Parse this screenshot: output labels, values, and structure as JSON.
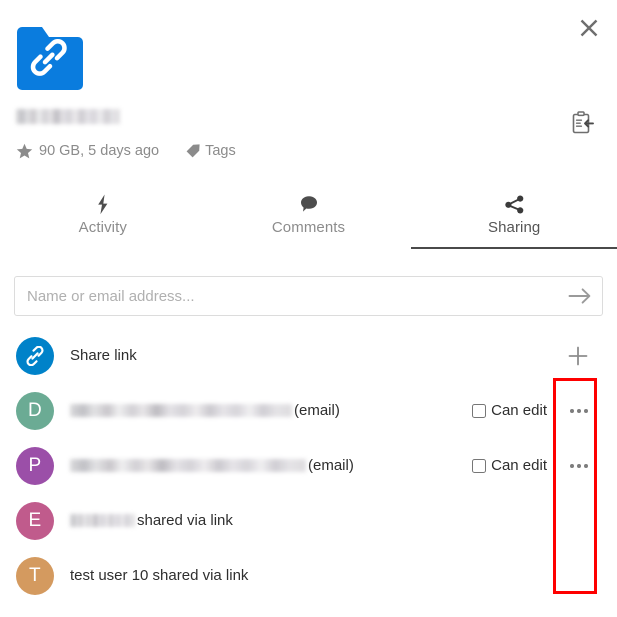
{
  "window": {
    "close_label": "×",
    "close_icon": "close-icon"
  },
  "file": {
    "icon": "folder-link-icon",
    "name_redacted": "",
    "favorite_icon": "star-icon",
    "size_and_time": "90 GB, 5 days ago",
    "tags_label": "Tags",
    "tags_icon": "tag-icon",
    "clipboard_icon": "clipboard-move-icon"
  },
  "tabs": [
    {
      "label": "Activity",
      "icon": "lightning-icon",
      "active": false
    },
    {
      "label": "Comments",
      "icon": "comment-bubble-icon",
      "active": false
    },
    {
      "label": "Sharing",
      "icon": "share-icon",
      "active": true
    }
  ],
  "share_input": {
    "value": "",
    "placeholder": "Name or email address...",
    "submit_icon": "arrow-right-icon"
  },
  "share_rows": [
    {
      "type": "link",
      "avatar_letter": "",
      "avatar_icon": "link-icon",
      "avatar_color": "#0082c9",
      "label": "Share link",
      "label_redacted": "",
      "action_icon": "plus-icon",
      "action_label": "+",
      "has_permission": false,
      "has_menu": false
    },
    {
      "type": "user",
      "avatar_letter": "D",
      "avatar_color": "#6bab94",
      "label_redacted": "redacted-name-email",
      "label_suffix": "(email)",
      "permission_label": "Can edit",
      "permission_checked": false,
      "has_permission": true,
      "has_menu": true,
      "menu_icon": "more-options-icon"
    },
    {
      "type": "user",
      "avatar_letter": "P",
      "avatar_color": "#9b4fa8",
      "label_redacted": "redacted-name-email",
      "label_suffix": "(email)",
      "permission_label": "Can edit",
      "permission_checked": false,
      "has_permission": true,
      "has_menu": true,
      "menu_icon": "more-options-icon"
    },
    {
      "type": "user",
      "avatar_letter": "E",
      "avatar_color": "#c05b8c",
      "label_redacted": "redacted-name",
      "label_suffix": "shared via link",
      "has_permission": false,
      "has_menu": false
    },
    {
      "type": "user",
      "avatar_letter": "T",
      "avatar_color": "#d49a5f",
      "label_redacted": "",
      "label_suffix": "test user 10 shared via link",
      "has_permission": false,
      "has_menu": false
    }
  ],
  "annotation": {
    "highlight_color": "#fe0000",
    "highlight_target": "more-options-menu-column"
  },
  "colors": {
    "accent_blue": "#0082c9",
    "text_primary": "#2e2e2e",
    "text_muted": "#8b8b8b",
    "tab_active_underline": "#4a4a4a"
  }
}
